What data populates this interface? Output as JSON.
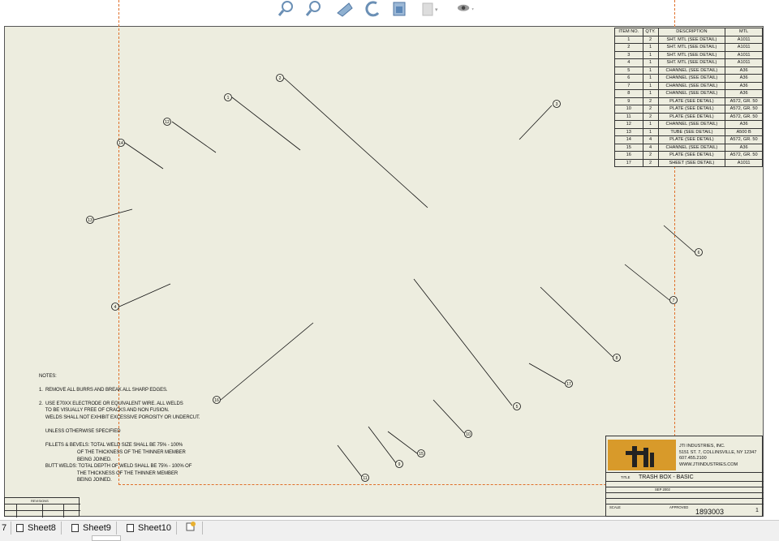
{
  "toolbar": {
    "icons": [
      "zoom-to-fit-icon",
      "zoom-area-icon",
      "previous-view-icon",
      "rotate-view-icon",
      "view-orientation-icon",
      "display-style-icon",
      "hide-show-items-icon"
    ]
  },
  "bom": {
    "headers": [
      "ITEM NO.",
      "QTY.",
      "DESCRIPTION",
      "MTL"
    ],
    "rows": [
      [
        "1",
        "2",
        "SHT. MTL (SEE DETAIL)",
        "A1011"
      ],
      [
        "2",
        "1",
        "SHT. MTL (SEE DETAIL)",
        "A1011"
      ],
      [
        "3",
        "1",
        "SHT. MTL (SEE DETAIL)",
        "A1011"
      ],
      [
        "4",
        "1",
        "SHT. MTL (SEE DETAIL)",
        "A1011"
      ],
      [
        "5",
        "1",
        "CHANNEL (SEE DETAIL)",
        "A36"
      ],
      [
        "6",
        "1",
        "CHANNEL (SEE DETAIL)",
        "A36"
      ],
      [
        "7",
        "1",
        "CHANNEL (SEE DETAIL)",
        "A36"
      ],
      [
        "8",
        "1",
        "CHANNEL (SEE DETAIL)",
        "A36"
      ],
      [
        "9",
        "2",
        "PLATE (SEE DETAIL)",
        "A572, GR. 50"
      ],
      [
        "10",
        "2",
        "PLATE (SEE DETAIL)",
        "A572, GR. 50"
      ],
      [
        "11",
        "2",
        "PLATE (SEE DETAIL)",
        "A572, GR. 50"
      ],
      [
        "12",
        "1",
        "CHANNEL (SEE DETAIL)",
        "A36"
      ],
      [
        "13",
        "1",
        "TUBE (SEE DETAIL)",
        "A500 B"
      ],
      [
        "14",
        "4",
        "PLATE (SEE DETAIL)",
        "A572, GR. 50"
      ],
      [
        "15",
        "4",
        "CHANNEL (SEE DETAIL)",
        "A36"
      ],
      [
        "16",
        "2",
        "PLATE (SEE DETAIL)",
        "A572, GR. 50"
      ],
      [
        "17",
        "2",
        "SHEET (SEE DETAIL)",
        "A1011"
      ]
    ]
  },
  "balloons": [
    "1",
    "2",
    "3",
    "4",
    "5",
    "6",
    "7",
    "8",
    "9",
    "10",
    "11",
    "12",
    "13",
    "14",
    "15",
    "16",
    "17"
  ],
  "notes": {
    "heading": "NOTES:",
    "lines": [
      "1.  REMOVE ALL BURRS AND BREAK ALL SHARP EDGES.",
      "",
      "2.  USE E70XX ELECTRODE OR EQUIVALENT WIRE. ALL WELDS",
      "     TO BE VISUALLY FREE OF CRACKS AND NON FUSION.",
      "     WELDS SHALL NOT EXHIBIT EXCESSIVE POROSITY OR UNDERCUT.",
      "",
      "     UNLESS OTHERWISE SPECIFIED",
      "",
      "     FILLETS & BEVELS: TOTAL WELD SIZE SHALL BE 75% - 100%",
      "                              OF THE THICKNESS OF THE THINNER MEMBER",
      "                              BEING JOINED.",
      "     BUTT WELDS: TOTAL DEPTH OF WELD SHALL BE 75% - 100% OF",
      "                              THE THICKNESS OF THE THINNER MEMBER",
      "                              BEING JOINED."
    ]
  },
  "title_block": {
    "company_lines": [
      "JTI INDUSTRIES, INC.",
      "5151 ST. 7, COLLINSVILLE, NY 12347",
      "607.455.2100",
      "WWW.JTIINDUSTRIES.COM"
    ],
    "title": "TRASH BOX - BASIC",
    "drawing_number": "1893003",
    "sheet_number": "1",
    "date": "SEP 2002",
    "scale_label": "SCALE",
    "approved_label": "APPROVED"
  },
  "revision_block": {
    "label": "REVISIONS"
  },
  "sheet_tabs": [
    "Sheet8",
    "Sheet9",
    "Sheet10"
  ],
  "tab_prefix": "7"
}
